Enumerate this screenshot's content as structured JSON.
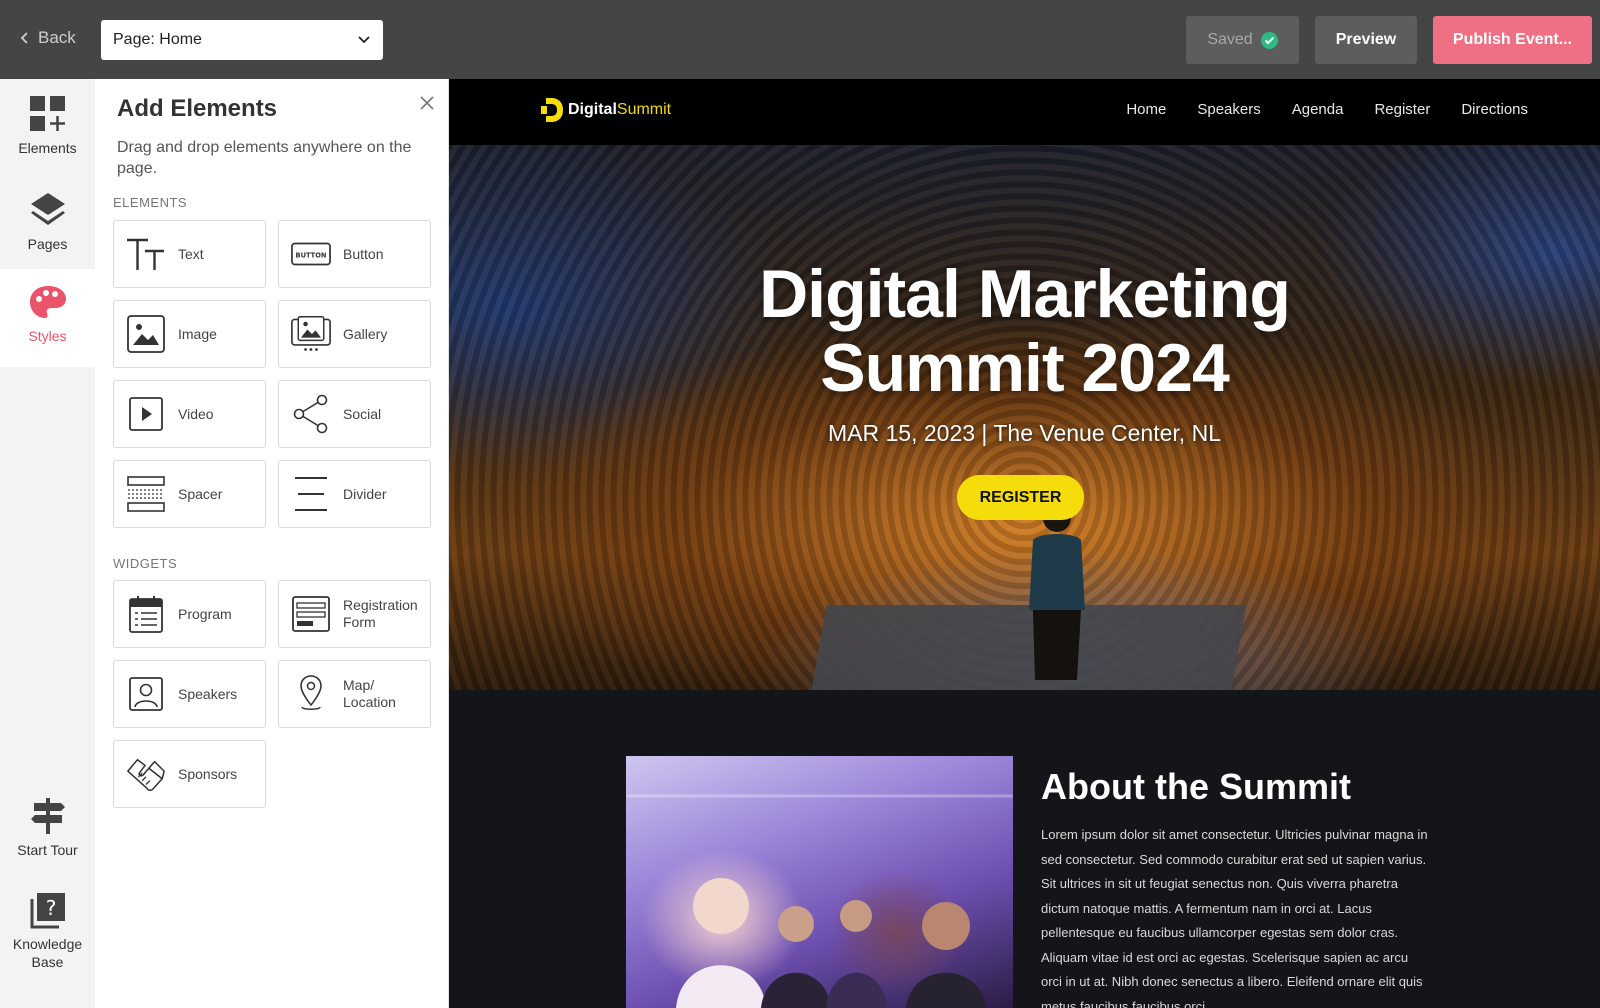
{
  "topbar": {
    "back_label": "Back",
    "page_select_value": "Page: Home",
    "saved_label": "Saved",
    "preview_label": "Preview",
    "publish_label": "Publish Event...",
    "colors": {
      "bar": "#454545",
      "publish": "#ef6f84",
      "saved_check": "#2fb985"
    }
  },
  "rail": {
    "items": [
      {
        "label": "Elements",
        "icon": "grid-plus-icon"
      },
      {
        "label": "Pages",
        "icon": "layers-icon"
      },
      {
        "label": "Styles",
        "icon": "palette-icon",
        "active": true
      },
      {
        "label": "Start Tour",
        "icon": "signpost-icon"
      },
      {
        "label": "Knowledge Base",
        "icon": "help-book-icon"
      }
    ],
    "active_color": "#e9546b"
  },
  "panel": {
    "title": "Add Elements",
    "description": "Drag and drop elements anywhere on the page.",
    "elements_heading": "ELEMENTS",
    "elements": [
      {
        "label": "Text",
        "icon": "text-icon"
      },
      {
        "label": "Button",
        "icon": "button-icon"
      },
      {
        "label": "Image",
        "icon": "image-icon"
      },
      {
        "label": "Gallery",
        "icon": "gallery-icon"
      },
      {
        "label": "Video",
        "icon": "video-icon"
      },
      {
        "label": "Social",
        "icon": "share-icon"
      },
      {
        "label": "Spacer",
        "icon": "spacer-icon"
      },
      {
        "label": "Divider",
        "icon": "divider-icon"
      }
    ],
    "widgets_heading": "WIDGETS",
    "widgets": [
      {
        "label": "Program",
        "icon": "calendar-icon"
      },
      {
        "label": "Registration Form",
        "icon": "form-icon"
      },
      {
        "label": "Speakers",
        "icon": "speaker-portrait-icon"
      },
      {
        "label": "Map/ Location",
        "icon": "map-pin-icon"
      },
      {
        "label": "Sponsors",
        "icon": "handshake-icon"
      }
    ],
    "button_icon_text": "BUTTON"
  },
  "site": {
    "logo_main": "Digital",
    "logo_accent": "Summit",
    "nav": [
      "Home",
      "Speakers",
      "Agenda",
      "Register",
      "Directions"
    ],
    "hero_title_line1": "Digital Marketing",
    "hero_title_line2": "Summit 2024",
    "hero_subtitle": "MAR 15, 2023 | The Venue Center, NL",
    "hero_button": "REGISTER",
    "about_title": "About the Summit",
    "about_body": "Lorem ipsum dolor sit amet consectetur. Ultricies pulvinar magna in sed consectetur. Sed commodo curabitur erat sed ut sapien varius. Sit ultrices in sit ut feugiat senectus non. Quis viverra pharetra dictum natoque mattis. A fermentum nam in orci at. Lacus pellentesque eu faucibus ullamcorper egestas sem dolor cras. Aliquam vitae id est orci ac egestas. Scelerisque sapien ac arcu orci in ut at. Nibh donec senectus a libero. Eleifend ornare elit quis metus faucibus faucibus orci.",
    "colors": {
      "accent": "#f5dc0b",
      "background": "#141519"
    }
  }
}
